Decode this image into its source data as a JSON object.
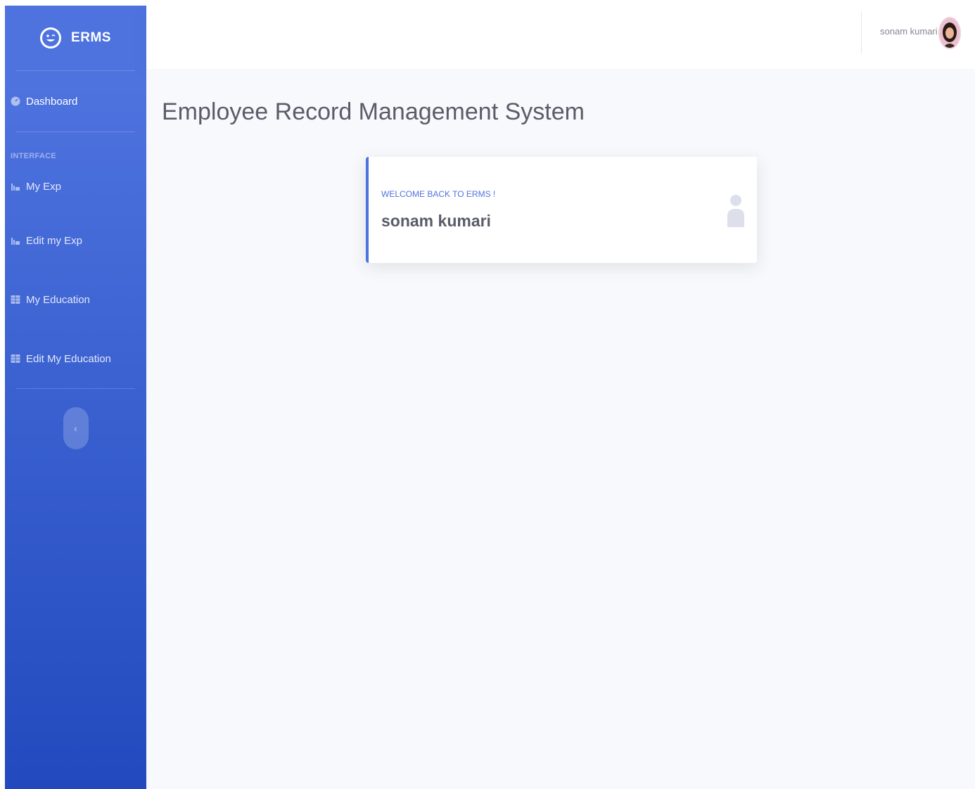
{
  "brand": {
    "name": "ERMS"
  },
  "sidebar": {
    "dashboard_label": "Dashboard",
    "heading": "INTERFACE",
    "items": [
      {
        "label": "My Exp",
        "icon": "chart-area-icon"
      },
      {
        "label": "Edit my Exp",
        "icon": "chart-area-icon"
      },
      {
        "label": "My Education",
        "icon": "table-icon"
      },
      {
        "label": "Edit My Education",
        "icon": "table-icon"
      }
    ],
    "toggle_glyph": "‹"
  },
  "topbar": {
    "user_name": "sonam kumari"
  },
  "main": {
    "page_title": "Employee Record Management System",
    "card": {
      "label": "WELCOME BACK TO ERMS !",
      "value": "sonam kumari",
      "icon": "user-icon"
    }
  },
  "colors": {
    "primary": "#4e73df",
    "primary_dark": "#224abe",
    "text_muted": "#858796",
    "text_dark": "#5a5c69",
    "background": "#f8f9fc"
  }
}
